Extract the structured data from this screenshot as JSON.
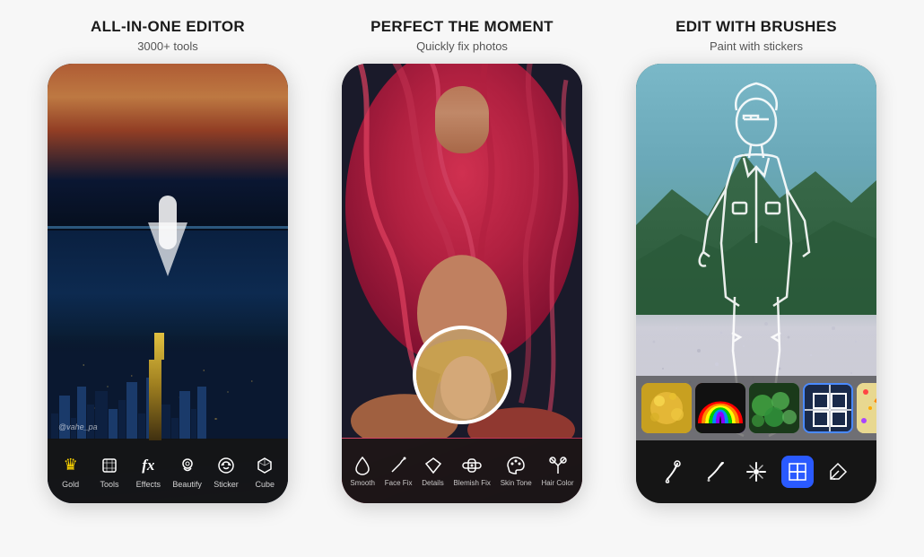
{
  "panels": [
    {
      "id": "panel1",
      "title": "ALL-IN-ONE EDITOR",
      "subtitle": "3000+ tools",
      "watermark": "@vahe_pa",
      "toolbar": {
        "items": [
          {
            "id": "gold",
            "label": "Gold",
            "icon": "crown"
          },
          {
            "id": "tools",
            "label": "Tools",
            "icon": "crop"
          },
          {
            "id": "effects",
            "label": "Effects",
            "icon": "fx"
          },
          {
            "id": "beautify",
            "label": "Beautify",
            "icon": "circle-face"
          },
          {
            "id": "sticker",
            "label": "Sticker",
            "icon": "star"
          },
          {
            "id": "cube",
            "label": "Cube",
            "icon": "cube"
          }
        ]
      }
    },
    {
      "id": "panel2",
      "title": "PERFECT THE MOMENT",
      "subtitle": "Quickly fix photos",
      "toolbar": {
        "items": [
          {
            "id": "smooth",
            "label": "Smooth",
            "icon": "drop"
          },
          {
            "id": "face-fix",
            "label": "Face Fix",
            "icon": "wand"
          },
          {
            "id": "details",
            "label": "Details",
            "icon": "diamond"
          },
          {
            "id": "blemish-fix",
            "label": "Blemish Fix",
            "icon": "bandage"
          },
          {
            "id": "skin-tone",
            "label": "Skin Tone",
            "icon": "palette"
          },
          {
            "id": "hair-color",
            "label": "Hair Color",
            "icon": "scissors"
          }
        ]
      }
    },
    {
      "id": "panel3",
      "title": "EDIT With BRUSHES",
      "subtitle": "Paint with stickers",
      "brush_strip": [
        {
          "id": "gold-glitter",
          "type": "gold"
        },
        {
          "id": "rainbow",
          "type": "rainbow"
        },
        {
          "id": "green-nature",
          "type": "green"
        },
        {
          "id": "selected",
          "type": "selected"
        },
        {
          "id": "confetti",
          "type": "confetti"
        },
        {
          "id": "more",
          "type": "more"
        }
      ],
      "toolbar": {
        "items": [
          {
            "id": "brush-tool",
            "label": "",
            "icon": "brush",
            "active": false
          },
          {
            "id": "brush-tool-2",
            "label": "",
            "icon": "brush2",
            "active": false
          },
          {
            "id": "sparkle",
            "label": "",
            "icon": "sparkle",
            "active": false
          },
          {
            "id": "stamp",
            "label": "",
            "icon": "stamp",
            "active": true
          },
          {
            "id": "eraser",
            "label": "",
            "icon": "eraser",
            "active": false
          }
        ]
      }
    }
  ]
}
